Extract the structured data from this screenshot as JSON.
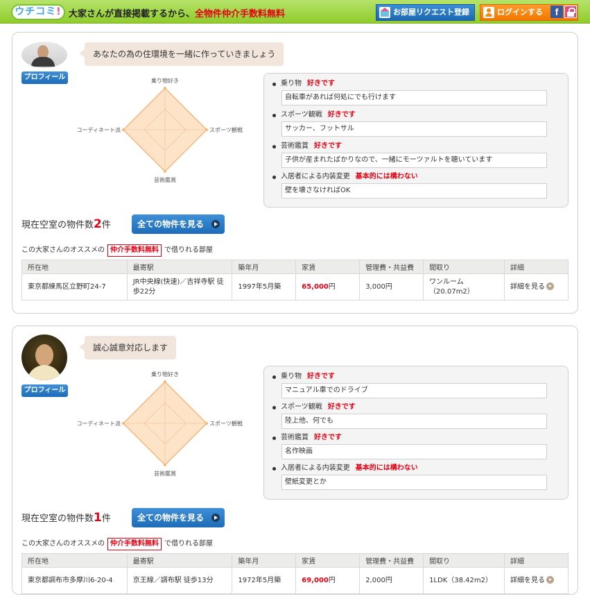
{
  "header": {
    "logo_text": "ウチコミ",
    "logo_exclaim": "!",
    "tagline_prefix": "大家さんが直接掲載するから、",
    "tagline_highlight": "全物件仲介手数料無料",
    "request_button": "お部屋リクエスト登録",
    "login_button": "ログインする",
    "facebook_icon_text": "f",
    "colors": {
      "header_green": "#8fcc2c",
      "accent_red": "#e60012",
      "button_blue": "#1e6cb8",
      "button_orange": "#f07800"
    }
  },
  "radar_labels": {
    "top": "乗り物好き",
    "right": "スポーツ観戦",
    "bottom": "芸術鑑賞",
    "left": "コーディネート派"
  },
  "landlords": [
    {
      "profile_label": "プロフィール",
      "message": "あなたの為の住環境を一緒に作っていきましょう",
      "radar_levels": {
        "top": 1.0,
        "right": 1.0,
        "bottom": 1.0,
        "left": 0.9
      },
      "preferences": [
        {
          "label": "乗り物",
          "value": "好きです",
          "comment": "自転車があれば何処にでも行けます"
        },
        {
          "label": "スポーツ観戦",
          "value": "好きです",
          "comment": "サッカー、フットサル"
        },
        {
          "label": "芸術鑑賞",
          "value": "好きです",
          "comment": "子供が産まれたばかりなので、一緒にモーツァルトを聴いています"
        },
        {
          "label": "入居者による内装変更",
          "value": "基本的には構わない",
          "comment": "壁を壊さなければOK"
        }
      ],
      "vacancy_prefix": "現在空室の物件数",
      "vacancy_count": "2",
      "vacancy_suffix": "件",
      "see_all_button": "全ての物件を見る",
      "reco_prefix": "この大家さんのオススメの",
      "reco_badge": "仲介手数料無料",
      "reco_suffix": "で借りれる部屋",
      "table_headers": [
        "所在地",
        "最寄駅",
        "築年月",
        "家賃",
        "管理費・共益費",
        "間取り",
        "詳細"
      ],
      "rows": [
        {
          "address": "東京都練馬区立野町24-7",
          "station": "JR中央線(快速)／吉祥寺駅 徒歩22分",
          "built": "1997年5月築",
          "rent": "65,000",
          "rent_unit": "円",
          "fee": "3,000円",
          "layout": "ワンルーム（20.07m2）",
          "detail": "詳細を見る"
        }
      ]
    },
    {
      "profile_label": "プロフィール",
      "message": "誠心誠意対応します",
      "radar_levels": {
        "top": 1.0,
        "right": 1.0,
        "bottom": 1.0,
        "left": 0.9
      },
      "preferences": [
        {
          "label": "乗り物",
          "value": "好きです",
          "comment": "マニュアル車でのドライブ"
        },
        {
          "label": "スポーツ観戦",
          "value": "好きです",
          "comment": "陸上他、何でも"
        },
        {
          "label": "芸術鑑賞",
          "value": "好きです",
          "comment": "名作映画"
        },
        {
          "label": "入居者による内装変更",
          "value": "基本的には構わない",
          "comment": "壁紙変更とか"
        }
      ],
      "vacancy_prefix": "現在空室の物件数",
      "vacancy_count": "1",
      "vacancy_suffix": "件",
      "see_all_button": "全ての物件を見る",
      "reco_prefix": "この大家さんのオススメの",
      "reco_badge": "仲介手数料無料",
      "reco_suffix": "で借りれる部屋",
      "table_headers": [
        "所在地",
        "最寄駅",
        "築年月",
        "家賃",
        "管理費・共益費",
        "間取り",
        "詳細"
      ],
      "rows": [
        {
          "address": "東京都調布市多摩川6-20-4",
          "station": "京王線／調布駅 徒歩13分",
          "built": "1972年5月築",
          "rent": "69,000",
          "rent_unit": "円",
          "fee": "2,000円",
          "layout": "1LDK（38.42m2）",
          "detail": "詳細を見る"
        }
      ]
    }
  ]
}
